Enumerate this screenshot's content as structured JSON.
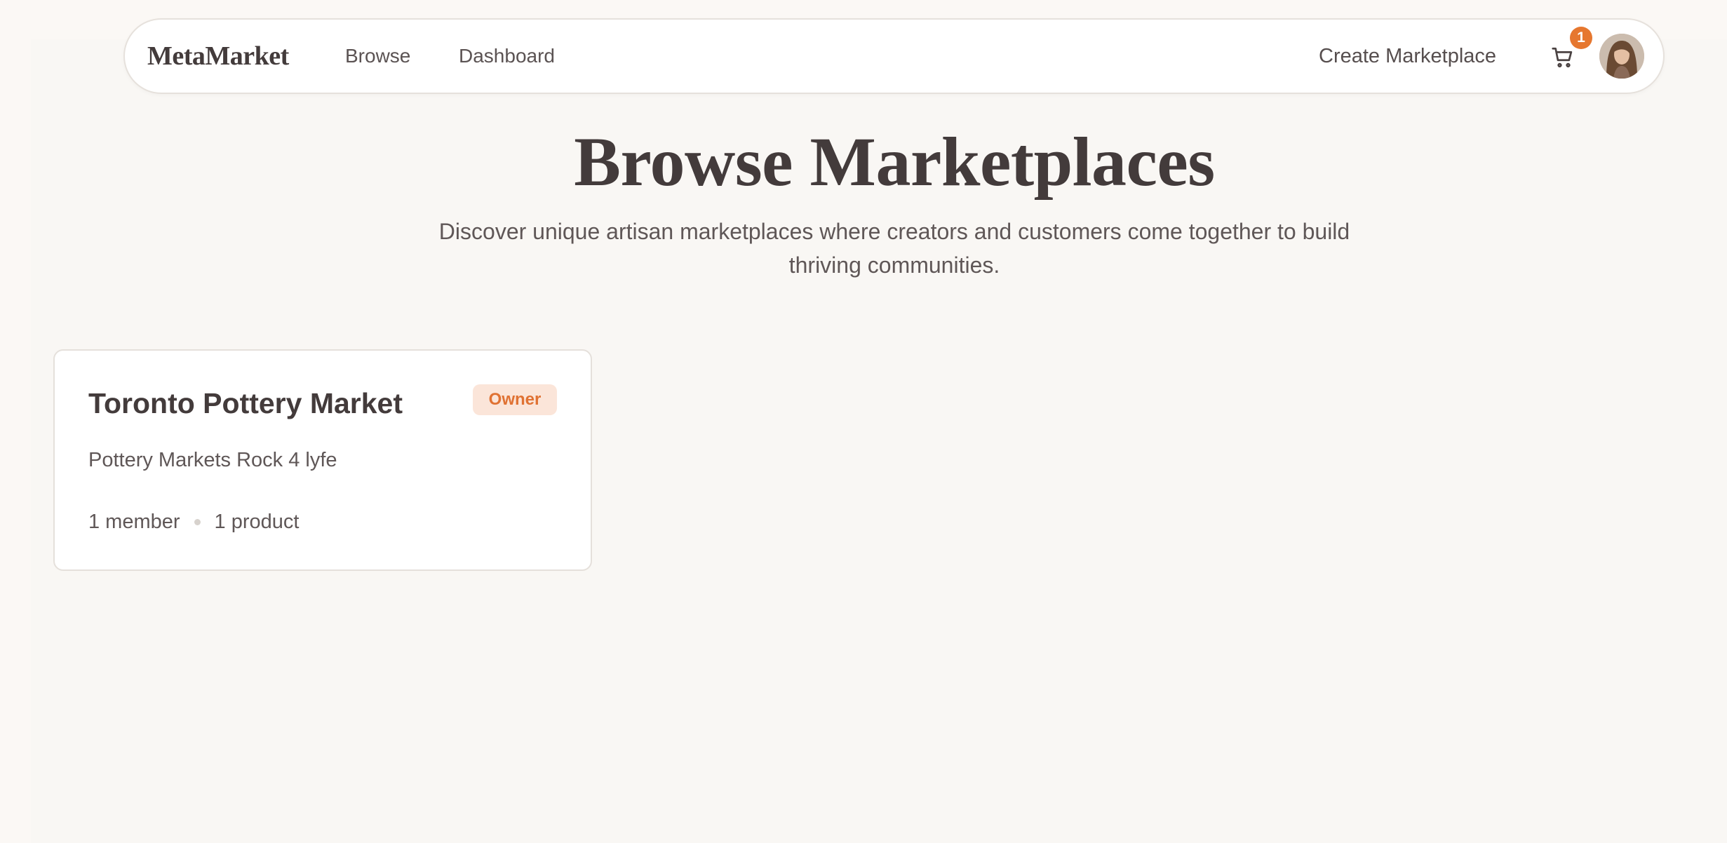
{
  "navbar": {
    "brand": "MetaMarket",
    "links": [
      {
        "label": "Browse"
      },
      {
        "label": "Dashboard"
      }
    ],
    "create_label": "Create Marketplace",
    "cart_count": "1",
    "icons": {
      "cart": "shopping-cart-icon",
      "avatar": "user-avatar"
    }
  },
  "hero": {
    "title": "Browse Marketplaces",
    "subtitle": "Discover unique artisan marketplaces where creators and customers come together to build thriving communities."
  },
  "marketplaces": [
    {
      "name": "Toronto Pottery Market",
      "badge": "Owner",
      "description": "Pottery Markets Rock 4 lyfe",
      "members": "1 member",
      "products": "1 product"
    }
  ],
  "colors": {
    "accent": "#e6772f",
    "badge_bg": "#fbe5d9",
    "text": "#433b3b",
    "background": "#f9f7f4"
  }
}
